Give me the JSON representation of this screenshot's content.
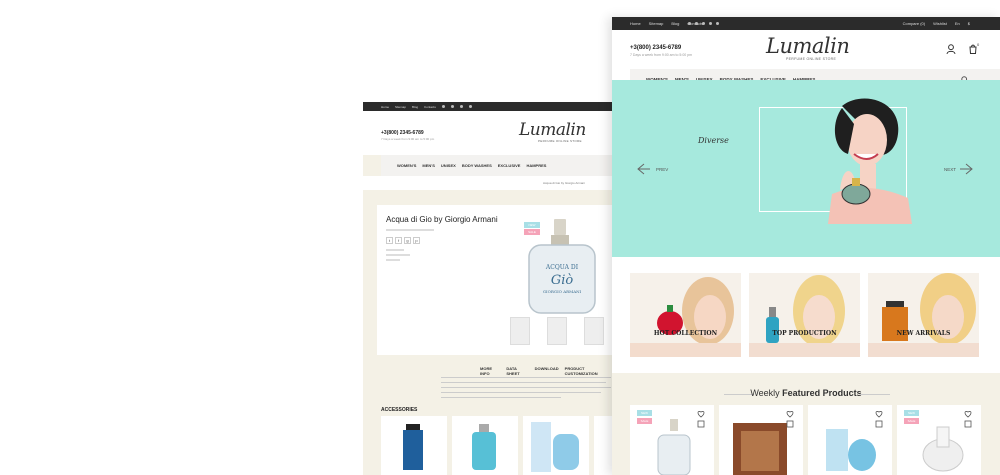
{
  "back_page": {
    "topbar_links": [
      "Home",
      "Sitemap",
      "Blog",
      "Contacts"
    ],
    "phone": "+3(800) 2345-6789",
    "phone_sub": "7 Days a week from 9:00 am to 5:00 pm",
    "logo": "Lumalin",
    "logo_sub": "PERFUME ONLINE STORE",
    "nav": [
      "WOMEN'S",
      "MEN'S",
      "UNISEX",
      "BODY WASHES",
      "EXCLUSIVE",
      "HAMPRES"
    ],
    "breadcrumb": "Acqua di Gio by Giorgio Armani",
    "product": {
      "title": "Acqua di Gio by Giorgio Armani",
      "badge_new": "NEW",
      "badge_sale": "SALE",
      "bottle_label_1": "ACQUA DI",
      "bottle_label_2": "Giò",
      "bottle_label_3": "GIORGIO ARMANI"
    },
    "tabs": [
      "MORE INFO",
      "DATA SHEET",
      "DOWNLOAD",
      "PRODUCT CUSTOMIZATION"
    ],
    "accessories_label": "ACCESSORIES"
  },
  "front_page": {
    "topbar_links": [
      "Home",
      "Sitemap",
      "Blog",
      "Contacts"
    ],
    "topbar_right": [
      "Compare (0)",
      "Wishlist",
      "En",
      "$"
    ],
    "phone": "+3(800) 2345-6789",
    "phone_sub": "7 Days a week from 9:00 am to 5:00 pm",
    "logo": "Lumalin",
    "logo_sub": "PERFUME ONLINE STORE",
    "nav": [
      "WOMEN'S",
      "MEN'S",
      "UNISEX",
      "BODY WASHES",
      "EXCLUSIVE",
      "HAMPRES"
    ],
    "cart_count": "0",
    "hero": {
      "title": "Diverse",
      "prev": "PREV",
      "next": "NEXT"
    },
    "banners": [
      "HOT COLLECTION",
      "TOP PRODUCTION",
      "NEW ARRIVALS"
    ],
    "featured_prefix": "Weekly",
    "featured_title": "Featured Products",
    "badge_new": "NEW",
    "badge_sale": "SALE"
  },
  "colors": {
    "accent_mint": "#a6e9dd",
    "badge_new": "#a8dfe6",
    "badge_sale": "#f5a3b8",
    "topbar": "#2b2b2b",
    "cream": "#f4f1e6"
  }
}
